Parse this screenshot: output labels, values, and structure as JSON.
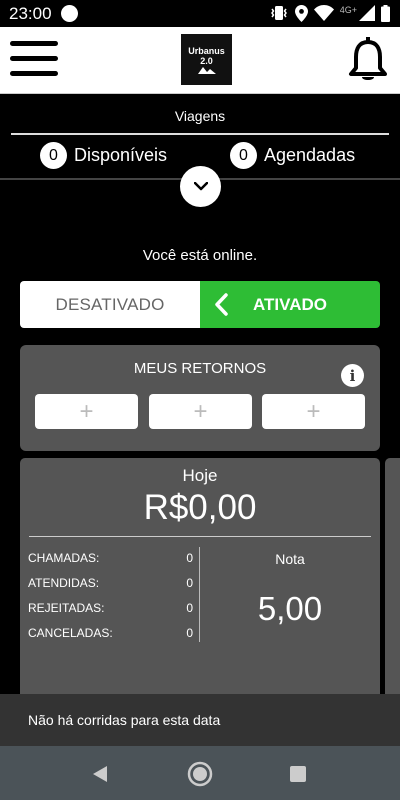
{
  "status_bar": {
    "time": "23:00",
    "network": "4G+"
  },
  "header": {
    "logo_line1": "Urbanus",
    "logo_line2": "2.0"
  },
  "trips": {
    "title": "Viagens",
    "available_count": "0",
    "available_label": "Disponíveis",
    "scheduled_count": "0",
    "scheduled_label": "Agendadas"
  },
  "online_status": "Você está online.",
  "toggle": {
    "off_label": "DESATIVADO",
    "on_label": "ATIVADO",
    "active": "on",
    "active_color": "#2ebd35"
  },
  "returns": {
    "title": "MEUS RETORNOS",
    "info_icon": "i",
    "slot_glyph": "+"
  },
  "today": {
    "title": "Hoje",
    "amount": "R$0,00",
    "stats": [
      {
        "label": "CHAMADAS:",
        "value": "0"
      },
      {
        "label": "ATENDIDAS:",
        "value": "0"
      },
      {
        "label": "REJEITADAS:",
        "value": "0"
      },
      {
        "label": "CANCELADAS:",
        "value": "0"
      }
    ],
    "nota_label": "Nota",
    "nota_value": "5,00"
  },
  "snackbar": "Não há corridas para esta data",
  "icons": [
    "menu-icon",
    "bell-icon",
    "chevron-down-icon",
    "chevron-left-icon",
    "info-icon",
    "plus-icon",
    "back-icon",
    "home-icon",
    "recents-icon"
  ]
}
